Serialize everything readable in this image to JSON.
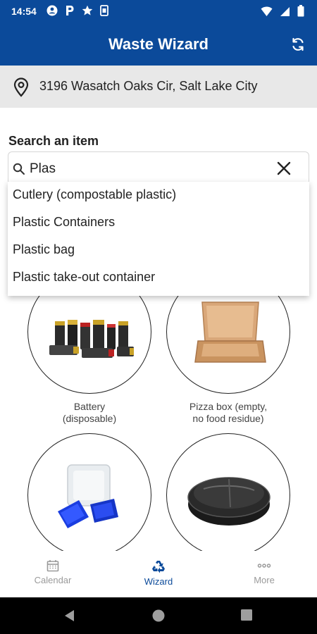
{
  "status_bar": {
    "time": "14:54",
    "left_icons": [
      "account-icon",
      "parking-icon",
      "star-icon",
      "sim-icon"
    ],
    "right_icons": [
      "wifi-icon",
      "signal-icon",
      "battery-icon"
    ]
  },
  "app_bar": {
    "title": "Waste Wizard",
    "refresh_icon": "refresh-icon",
    "color": "#0b4a9a"
  },
  "address": {
    "icon": "location-pin-icon",
    "text": "3196 Wasatch Oaks Cir, Salt Lake City"
  },
  "search": {
    "label": "Search an item",
    "value": "Plas",
    "icon": "search-icon",
    "clear_icon": "close-icon"
  },
  "suggestions": [
    "Cutlery (compostable plastic)",
    "Plastic Containers",
    "Plastic bag",
    "Plastic take-out container"
  ],
  "items": [
    {
      "label_line1": "Battery",
      "label_line2": "(disposable)"
    },
    {
      "label_line1": "Pizza box (empty,",
      "label_line2": "no food residue)"
    },
    {
      "label_line1": "",
      "label_line2": ""
    },
    {
      "label_line1": "",
      "label_line2": ""
    }
  ],
  "bottom_nav": {
    "items": [
      {
        "label": "Calendar",
        "icon": "calendar-icon",
        "active": false
      },
      {
        "label": "Wizard",
        "icon": "recycle-icon",
        "active": true
      },
      {
        "label": "More",
        "icon": "more-icon",
        "active": false
      }
    ],
    "active_color": "#0b4a9a",
    "inactive_color": "#9a9a9a"
  },
  "system_nav": [
    "back-icon",
    "home-icon",
    "recents-icon"
  ]
}
